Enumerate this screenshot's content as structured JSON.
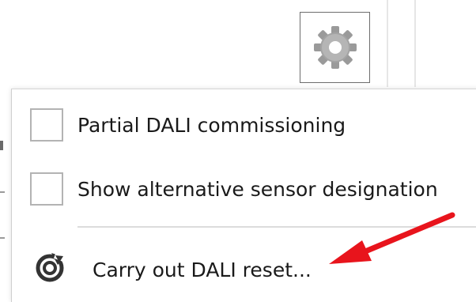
{
  "toolbar": {
    "settings_icon": "gear-icon"
  },
  "menu": {
    "items": [
      {
        "label": "Partial DALI commissioning",
        "checked": false
      },
      {
        "label": "Show alternative sensor designation",
        "checked": false
      }
    ],
    "action": {
      "label": "Carry out DALI reset...",
      "icon": "reset-icon"
    }
  },
  "colors": {
    "annotation_arrow": "#e8141c",
    "menu_background": "#ffffff",
    "text": "#1a1a1a"
  }
}
